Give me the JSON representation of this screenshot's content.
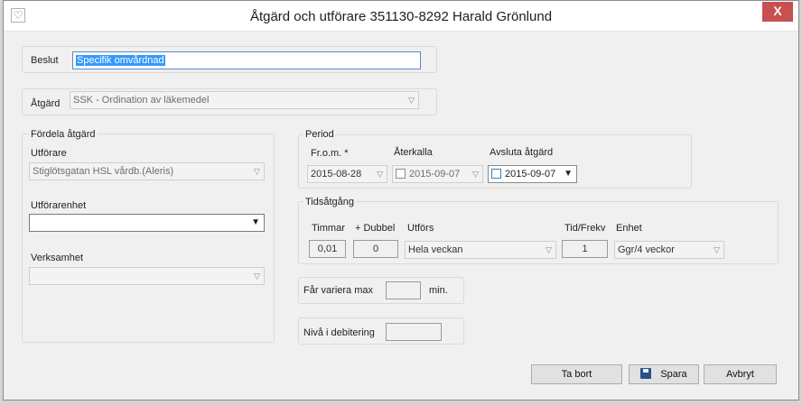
{
  "window": {
    "title": "Åtgärd och utförare 351130-8292 Harald Grönlund",
    "close_label": "X",
    "app_icon": "heart-icon"
  },
  "beslut": {
    "label": "Beslut",
    "value": "Specifik omvårdnad"
  },
  "atgard": {
    "label": "Åtgärd",
    "value": "SSK - Ordination av läkemedel"
  },
  "fordela": {
    "heading": "Fördela åtgärd",
    "utforare_label": "Utförare",
    "utforare_value": "Stiglötsgatan HSL vårdb.(Aleris)",
    "utforarenhet_label": "Utförarenhet",
    "utforarenhet_value": "",
    "verksamhet_label": "Verksamhet",
    "verksamhet_value": ""
  },
  "period": {
    "heading": "Period",
    "from_label": "Fr.o.m. *",
    "from_value": "2015-08-28",
    "aterkalla_label": "Återkalla",
    "aterkalla_value": "2015-09-07",
    "avsluta_label": "Avsluta åtgärd",
    "avsluta_value": "2015-09-07"
  },
  "tidsatgang": {
    "heading": "Tidsåtgång",
    "timmar_label": "Timmar",
    "timmar_value": "0,01",
    "dubbel_label": "+ Dubbel",
    "dubbel_value": "0",
    "utfors_label": "Utförs",
    "utfors_value": "Hela veckan",
    "frekv_label": "Tid/Frekv",
    "frekv_value": "1",
    "enhet_label": "Enhet",
    "enhet_value": "Ggr/4 veckor"
  },
  "variera": {
    "label": "Får variera max",
    "unit": "min.",
    "value": ""
  },
  "niva": {
    "label": "Nivå i debitering",
    "value": ""
  },
  "buttons": {
    "ta_bort": "Ta bort",
    "spara": "Spara",
    "avbryt": "Avbryt"
  }
}
